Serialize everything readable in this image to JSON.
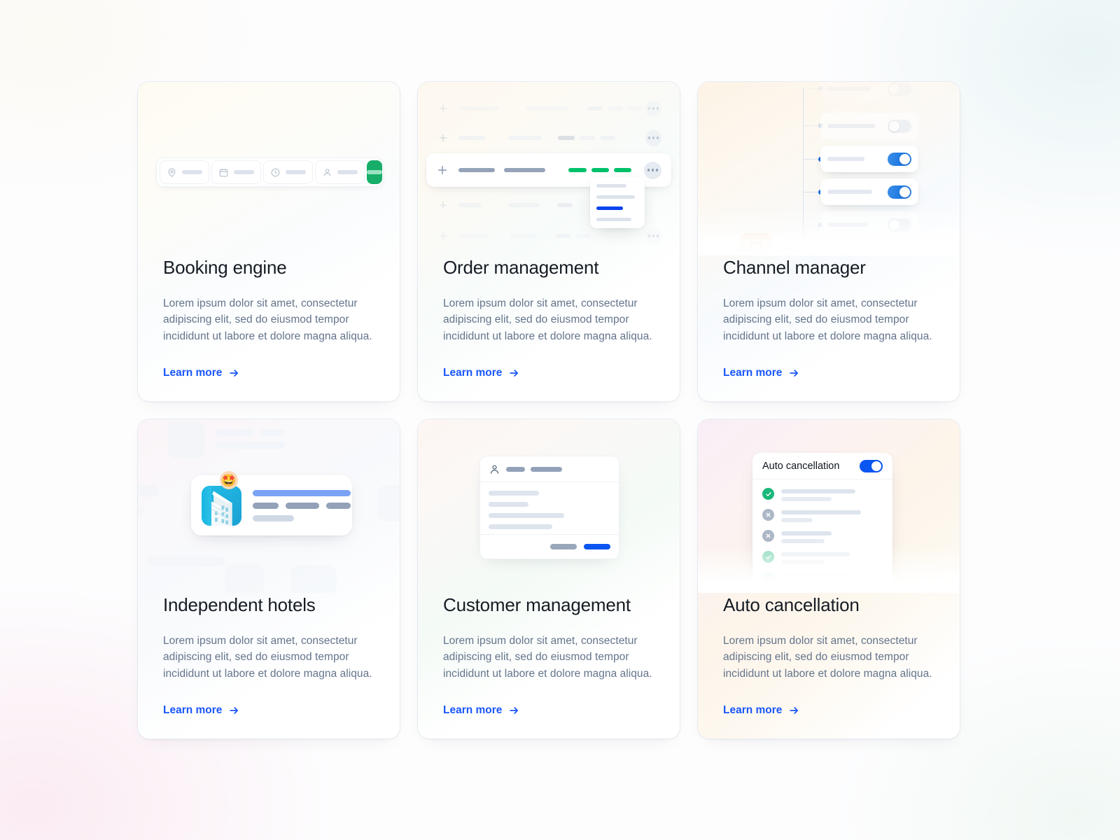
{
  "theme": {
    "link_color": "#1a56fa",
    "title_color": "#161c24",
    "desc_color": "#64748b",
    "accent_green": "#16ae68",
    "accent_blue": "#0b55f0",
    "accent_orange": "#fde3cb",
    "page_background": "#fdfdfe"
  },
  "cards": [
    {
      "id": "booking-engine",
      "title": "Booking engine",
      "description": "Lorem ipsum dolor sit amet, consectetur adipiscing elit, sed do eiusmod tempor incididunt ut labore et dolore magna aliqua.",
      "link_label": "Learn more",
      "illustration": {
        "type": "search-bar",
        "fields": [
          {
            "icon": "map-pin-icon"
          },
          {
            "icon": "calendar-icon"
          },
          {
            "icon": "clock-icon"
          },
          {
            "icon": "person-icon"
          }
        ],
        "submit_button": {
          "icon": "search-submit-button",
          "color": "#16ae68"
        }
      }
    },
    {
      "id": "order-management",
      "title": "Order management",
      "description": "Lorem ipsum dolor sit amet, consectetur adipiscing elit, sed do eiusmod tempor incididunt ut labore et dolore magna aliqua.",
      "link_label": "Learn more",
      "illustration": {
        "type": "order-rows",
        "rows": 5,
        "active_row_index": 2,
        "status_chip_color": "#00c16a",
        "menu": {
          "items": 4,
          "selected_index": 2,
          "selected_color": "#0b44f0"
        },
        "cursor": "hand-cursor-icon"
      }
    },
    {
      "id": "channel-manager",
      "title": "Channel manager",
      "description": "Lorem ipsum dolor sit amet, consectetur adipiscing elit, sed do eiusmod tempor incididunt ut labore et dolore magna aliqua.",
      "link_label": "Learn more",
      "illustration": {
        "type": "channel-tree",
        "source_icon": "hotel-building-icon",
        "channels": [
          {
            "enabled": false,
            "opacity": 0.18
          },
          {
            "enabled": false,
            "opacity": 0.55
          },
          {
            "enabled": true,
            "opacity": 1
          },
          {
            "enabled": true,
            "opacity": 1
          },
          {
            "enabled": false,
            "opacity": 0.55
          },
          {
            "enabled": false,
            "opacity": 0.18
          }
        ],
        "toggle_on_color": "#2f86e5",
        "toggle_off_color": "#e7ecf3"
      }
    },
    {
      "id": "independent-hotels",
      "title": "Independent hotels",
      "description": "Lorem ipsum dolor sit amet, consectetur adipiscing elit, sed do eiusmod tempor incididunt ut labore et dolore magna aliqua.",
      "link_label": "Learn more",
      "illustration": {
        "type": "hotel-listing",
        "thumbnail": "hotel-photo",
        "badge_emoji": "🤩",
        "badge_name": "star-struck-emoji",
        "title_line_color": "#7ba2f5",
        "tag_count": 3
      }
    },
    {
      "id": "customer-management",
      "title": "Customer management",
      "description": "Lorem ipsum dolor sit amet, consectetur adipiscing elit, sed do eiusmod tempor incididunt ut labore et dolore magna aliqua.",
      "link_label": "Learn more",
      "illustration": {
        "type": "customer-dialog",
        "header_icon": "person-icon",
        "body_lines": 4,
        "footer_buttons": [
          {
            "name": "cancel-button",
            "color": "#9aa7ba"
          },
          {
            "name": "confirm-button",
            "color": "#0b55f0"
          }
        ]
      }
    },
    {
      "id": "auto-cancellation",
      "title": "Auto cancellation",
      "description": "Lorem ipsum dolor sit amet, consectetur adipiscing elit, sed do eiusmod tempor incididunt ut labore et dolore magna aliqua.",
      "link_label": "Learn more",
      "illustration": {
        "type": "auto-cancellation-panel",
        "panel_title": "Auto cancellation",
        "toggle_state": "on",
        "toggle_color": "#0b55f0",
        "items": [
          {
            "status": "success",
            "opacity": 1
          },
          {
            "status": "failed",
            "opacity": 1
          },
          {
            "status": "failed",
            "opacity": 1
          },
          {
            "status": "success",
            "opacity": 0.45
          },
          {
            "status": "success",
            "opacity": 0.16
          }
        ],
        "success_color": "#19b87b",
        "failed_color": "#acb7c6"
      }
    }
  ]
}
